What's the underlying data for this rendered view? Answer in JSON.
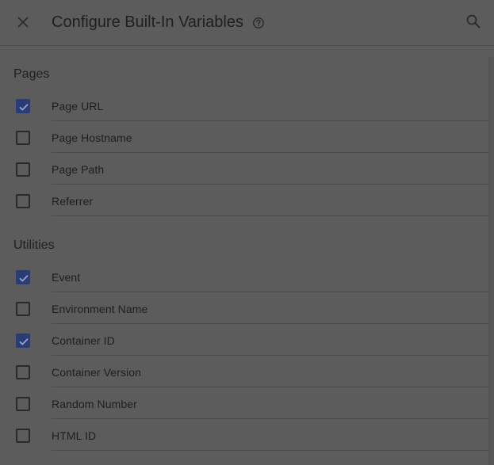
{
  "dialog": {
    "title": "Configure Built-In Variables"
  },
  "icons": {
    "close": "close-icon",
    "help": "help-icon",
    "search": "search-icon",
    "check": "check-icon"
  },
  "colors": {
    "overlay_background": "#5c5c5c",
    "checkbox_checked": "#2a3c78"
  },
  "sections": [
    {
      "title": "Pages",
      "items": [
        {
          "label": "Page URL",
          "checked": true
        },
        {
          "label": "Page Hostname",
          "checked": false
        },
        {
          "label": "Page Path",
          "checked": false
        },
        {
          "label": "Referrer",
          "checked": false
        }
      ]
    },
    {
      "title": "Utilities",
      "items": [
        {
          "label": "Event",
          "checked": true
        },
        {
          "label": "Environment Name",
          "checked": false
        },
        {
          "label": "Container ID",
          "checked": true
        },
        {
          "label": "Container Version",
          "checked": false
        },
        {
          "label": "Random Number",
          "checked": false
        },
        {
          "label": "HTML ID",
          "checked": false
        }
      ]
    }
  ]
}
